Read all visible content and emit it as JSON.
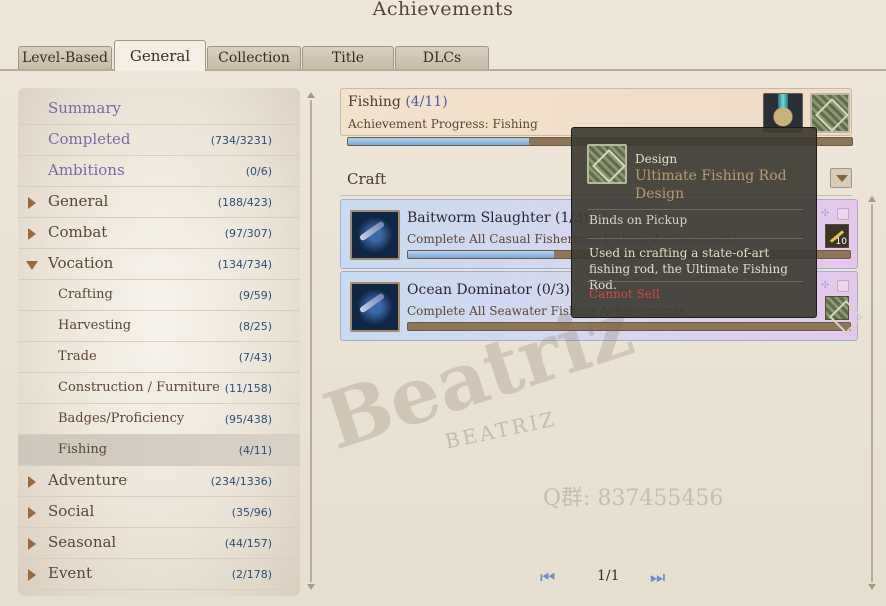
{
  "title": "Achievements",
  "tabs": [
    {
      "label": "Level-Based",
      "active": false
    },
    {
      "label": "General",
      "active": true
    },
    {
      "label": "Collection",
      "active": false
    },
    {
      "label": "Title",
      "active": false
    },
    {
      "label": "DLCs",
      "active": false
    }
  ],
  "sidebar": {
    "items": [
      {
        "label": "Summary",
        "count": "",
        "kind": "top"
      },
      {
        "label": "Completed",
        "count": "(734/3231)",
        "kind": "top"
      },
      {
        "label": "Ambitions",
        "count": "(0/6)",
        "kind": "top"
      },
      {
        "label": "General",
        "count": "(188/423)",
        "kind": "cat",
        "expanded": false
      },
      {
        "label": "Combat",
        "count": "(97/307)",
        "kind": "cat",
        "expanded": false
      },
      {
        "label": "Vocation",
        "count": "(134/734)",
        "kind": "cat",
        "expanded": true
      },
      {
        "label": "Crafting",
        "count": "(9/59)",
        "kind": "sub"
      },
      {
        "label": "Harvesting",
        "count": "(8/25)",
        "kind": "sub"
      },
      {
        "label": "Trade",
        "count": "(7/43)",
        "kind": "sub"
      },
      {
        "label": "Construction / Furniture",
        "count": "(11/158)",
        "kind": "sub"
      },
      {
        "label": "Badges/Proficiency",
        "count": "(95/438)",
        "kind": "sub"
      },
      {
        "label": "Fishing",
        "count": "(4/11)",
        "kind": "sub",
        "selected": true
      },
      {
        "label": "Adventure",
        "count": "(234/1336)",
        "kind": "cat",
        "expanded": false
      },
      {
        "label": "Social",
        "count": "(35/96)",
        "kind": "cat",
        "expanded": false
      },
      {
        "label": "Seasonal",
        "count": "(44/157)",
        "kind": "cat",
        "expanded": false
      },
      {
        "label": "Event",
        "count": "(2/178)",
        "kind": "cat",
        "expanded": false
      }
    ]
  },
  "header": {
    "name": "Fishing",
    "progress_text": "(4/11)",
    "desc": "Achievement Progress: Fishing",
    "progress": 0.36
  },
  "filter": {
    "label": "Craft"
  },
  "achievements": [
    {
      "name": "Baitworm Slaughter",
      "progress_text": "(1/3)",
      "desc": "Complete All Casual Fisherman Fishing Achievements",
      "progress": 0.33,
      "reward_qty": "10"
    },
    {
      "name": "Ocean Dominator",
      "progress_text": "(0/3)",
      "desc": "Complete All Seawater Fishing Achievements",
      "progress": 0.0,
      "reward_qty": ""
    }
  ],
  "tooltip": {
    "category": "Design",
    "name": "Ultimate Fishing Rod Design",
    "binding": "Binds on Pickup",
    "desc": "Used in crafting a state-of-art fishing rod, the Ultimate Fishing Rod.",
    "sell": "Cannot Sell"
  },
  "pager": {
    "text": "1/1"
  },
  "watermark": {
    "main": "Beatriz",
    "sub": "BEATRIZ",
    "qq": "Q群: 837455456"
  },
  "colors": {
    "progress_fill": "#7ea8d8",
    "count_text": "#2b4f7a",
    "cannot_sell": "#d24848"
  }
}
